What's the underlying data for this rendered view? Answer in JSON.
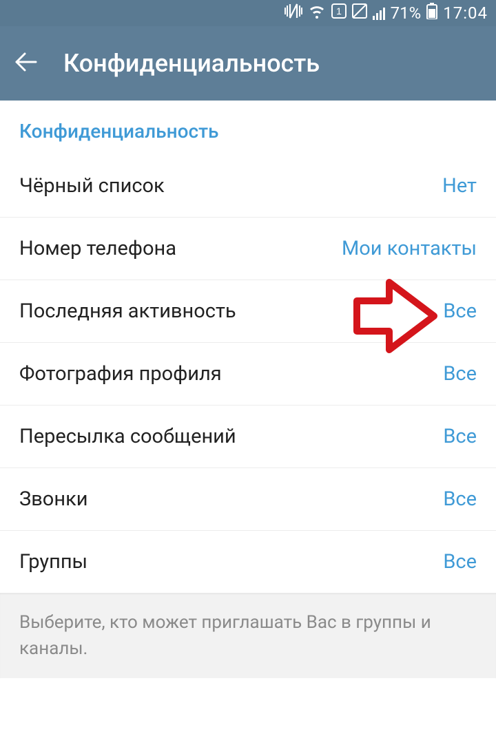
{
  "status": {
    "battery_pct": "71%",
    "time": "17:04"
  },
  "header": {
    "title": "Конфиденциальность"
  },
  "section_title": "Конфиденциальность",
  "rows": {
    "blocklist": {
      "label": "Чёрный список",
      "value": "Нет"
    },
    "phone": {
      "label": "Номер телефона",
      "value": "Мои контакты"
    },
    "lastseen": {
      "label": "Последняя активность",
      "value": "Все"
    },
    "photo": {
      "label": "Фотография профиля",
      "value": "Все"
    },
    "forward": {
      "label": "Пересылка сообщений",
      "value": "Все"
    },
    "calls": {
      "label": "Звонки",
      "value": "Все"
    },
    "groups": {
      "label": "Группы",
      "value": "Все"
    }
  },
  "hint": "Выберите, кто может приглашать Вас в группы и каналы."
}
